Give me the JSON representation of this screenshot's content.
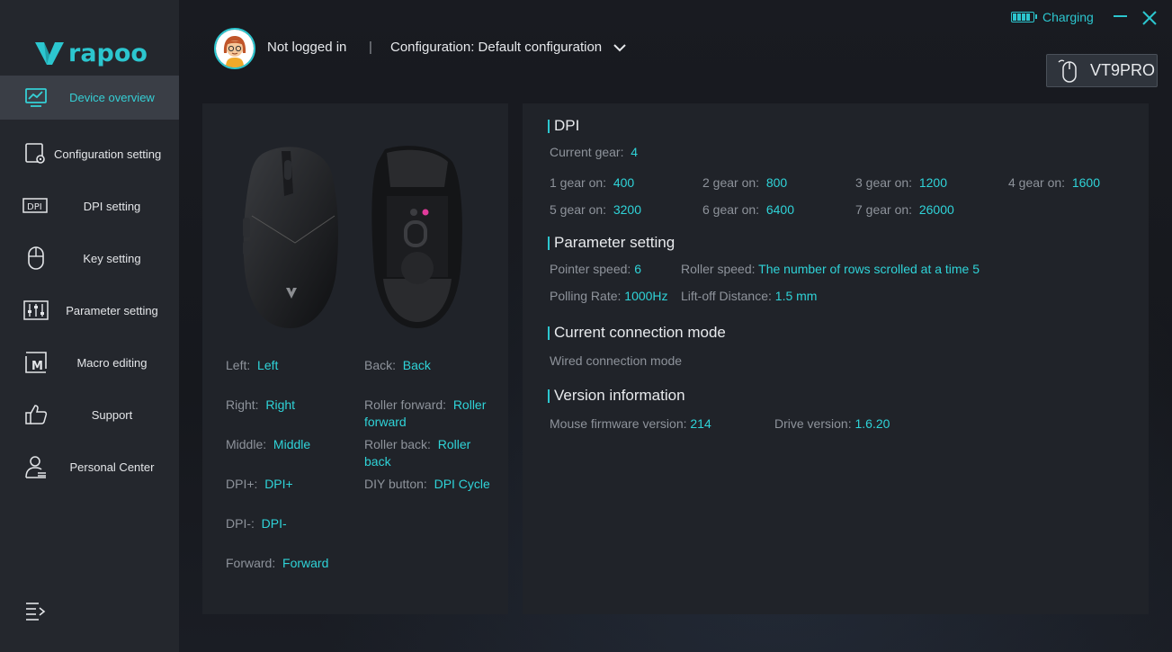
{
  "brand": {
    "logo_text": "rapoo"
  },
  "sidebar": {
    "items": [
      {
        "label": "Device overview",
        "icon": "monitor-chart-icon",
        "active": true
      },
      {
        "label": "Configuration setting",
        "icon": "config-gear-icon"
      },
      {
        "label": "DPI setting",
        "icon": "dpi-icon"
      },
      {
        "label": "Key setting",
        "icon": "mouse-icon"
      },
      {
        "label": "Parameter setting",
        "icon": "sliders-icon"
      },
      {
        "label": "Macro editing",
        "icon": "macro-icon"
      },
      {
        "label": "Support",
        "icon": "thumbs-up-icon"
      },
      {
        "label": "Personal Center",
        "icon": "person-icon"
      }
    ]
  },
  "header": {
    "user": "Not logged in",
    "separator": "|",
    "configuration": "Configuration: Default configuration",
    "status": "Charging",
    "device": "VT9PRO"
  },
  "buttons": {
    "left_col": [
      {
        "key": "Left:",
        "value": "Left"
      },
      {
        "key": "Right:",
        "value": "Right"
      },
      {
        "key": "Middle:",
        "value": "Middle"
      },
      {
        "key": "DPI+:",
        "value": "DPI+"
      },
      {
        "key": "DPI-:",
        "value": "DPI-"
      },
      {
        "key": "Forward:",
        "value": "Forward"
      }
    ],
    "right_col": [
      {
        "key": "Back:",
        "value": "Back"
      },
      {
        "key": "Roller forward:",
        "value": "Roller forward"
      },
      {
        "key": "Roller back:",
        "value": "Roller back"
      },
      {
        "key": "DIY button:",
        "value": "DPI Cycle"
      }
    ]
  },
  "dpi": {
    "title": "DPI",
    "current_label": "Current gear:",
    "current_value": "4",
    "gears": [
      {
        "label": "1 gear on:",
        "value": "400"
      },
      {
        "label": "2 gear on:",
        "value": "800"
      },
      {
        "label": "3 gear on:",
        "value": "1200"
      },
      {
        "label": "4 gear on:",
        "value": "1600"
      },
      {
        "label": "5 gear on:",
        "value": "3200"
      },
      {
        "label": "6 gear on:",
        "value": "6400"
      },
      {
        "label": "7 gear on:",
        "value": "26000"
      }
    ]
  },
  "params": {
    "title": "Parameter setting",
    "pointer_label": "Pointer speed:",
    "pointer_value": "6",
    "roller_label": "Roller speed:",
    "roller_value": "The number of rows scrolled at a time 5",
    "polling_label": "Polling Rate:",
    "polling_value": "1000Hz",
    "liftoff_label": "Lift-off Distance:",
    "liftoff_value": "1.5 mm"
  },
  "connection": {
    "title": "Current connection mode",
    "value": "Wired connection mode"
  },
  "version": {
    "title": "Version information",
    "firmware_label": "Mouse firmware version:",
    "firmware_value": "214",
    "drive_label": "Drive version:",
    "drive_value": "1.6.20"
  },
  "colors": {
    "accent": "#2cc6cf",
    "sidebar": "#24272d",
    "panel": "#202329",
    "value": "#2fd3d8"
  }
}
